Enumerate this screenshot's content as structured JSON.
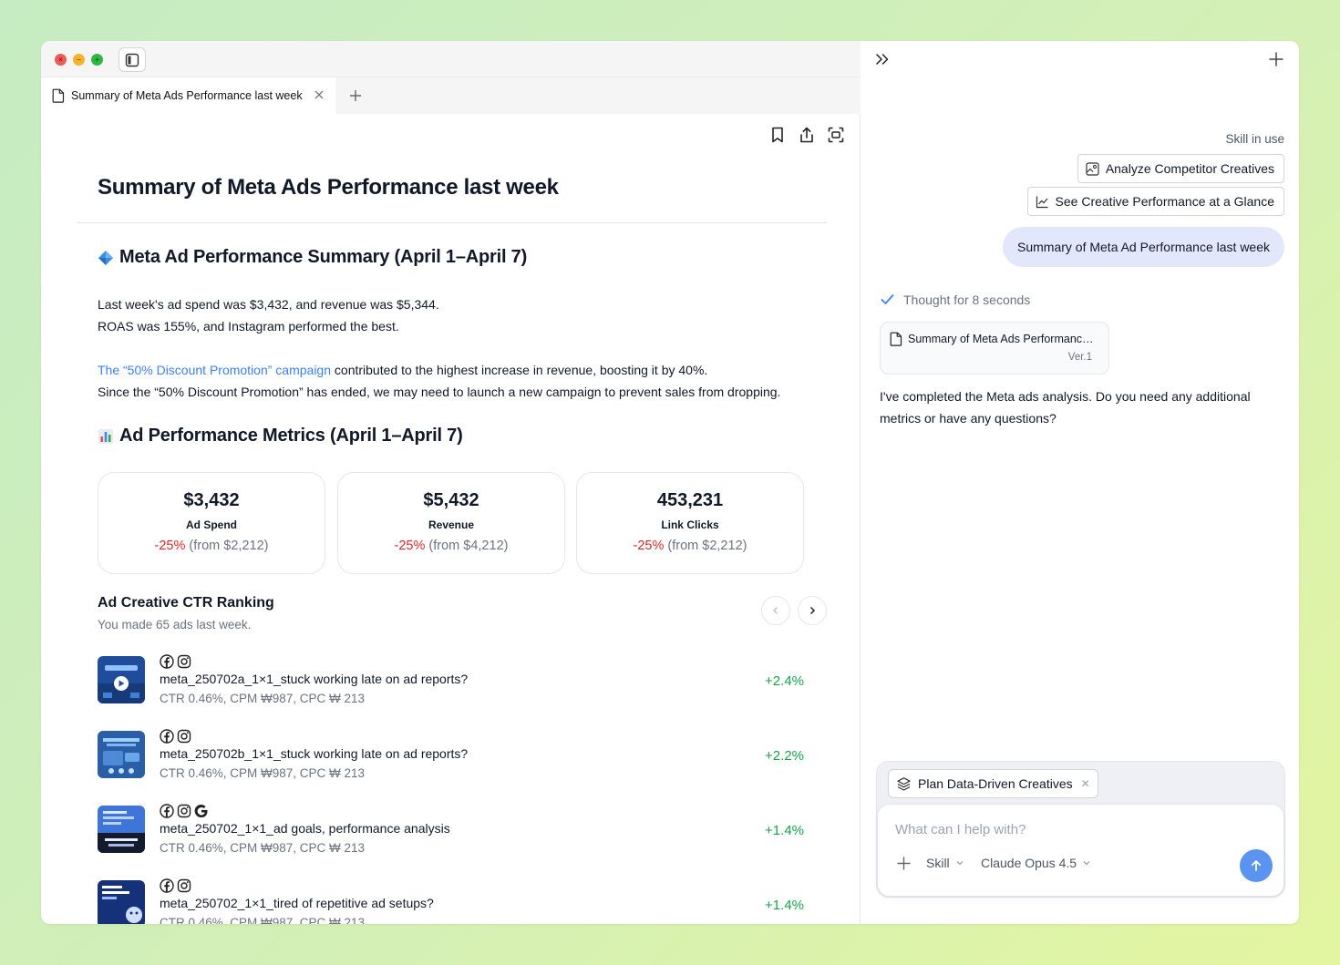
{
  "window": {
    "tab_title": "Summary of Meta Ads Performance last week"
  },
  "doc": {
    "title": "Summary of Meta Ads Performance last week",
    "summary_heading": "Meta Ad Performance Summary (April 1–April 7)",
    "summary_line1": "Last week's ad spend was $3,432, and revenue was $5,344.",
    "summary_line2": "ROAS was 155%, and Instagram performed the best.",
    "campaign_link": "The “50% Discount Promotion” campaign",
    "campaign_rest": " contributed to the highest increase in revenue, boosting it by 40%.",
    "campaign_line2": "Since the “50% Discount Promotion” has ended, we may need to launch a new campaign to prevent sales from dropping.",
    "metrics_heading": "Ad Performance Metrics (April 1–April 7)",
    "metrics": [
      {
        "value": "$3,432",
        "label": "Ad Spend",
        "change": "-25%",
        "from": "(from $2,212)"
      },
      {
        "value": "$5,432",
        "label": "Revenue",
        "change": "-25%",
        "from": "(from $4,212)"
      },
      {
        "value": "453,231",
        "label": "Link Clicks",
        "change": "-25%",
        "from": "(from $2,212)"
      }
    ],
    "ranking": {
      "title": "Ad Creative CTR Ranking",
      "subtitle": "You made 65 ads last week.",
      "ads": [
        {
          "name": "meta_250702a_1×1_stuck working late on ad reports?",
          "stats": "CTR 0.46%, CPM ₩987, CPC ₩ 213",
          "delta": "+2.4%",
          "platforms": [
            "facebook",
            "instagram"
          ]
        },
        {
          "name": "meta_250702b_1×1_stuck working late on ad reports?",
          "stats": "CTR 0.46%, CPM ₩987, CPC ₩ 213",
          "delta": "+2.2%",
          "platforms": [
            "facebook",
            "instagram"
          ]
        },
        {
          "name": "meta_250702_1×1_ad goals, performance analysis",
          "stats": "CTR 0.46%, CPM ₩987, CPC ₩ 213",
          "delta": "+1.4%",
          "platforms": [
            "facebook",
            "instagram",
            "google"
          ]
        },
        {
          "name": "meta_250702_1×1_tired of repetitive ad setups?",
          "stats": "CTR 0.46%, CPM ₩987, CPC ₩ 213",
          "delta": "+1.4%",
          "platforms": [
            "facebook",
            "instagram"
          ]
        }
      ]
    }
  },
  "chat": {
    "skill_label": "Skill in use",
    "skills": [
      "Analyze Competitor Creatives",
      "See Creative Performance at a Glance"
    ],
    "user_message": "Summary of Meta Ad Performance last week",
    "thought": "Thought for 8 seconds",
    "artifact_title": "Summary of Meta Ads Performance last week",
    "artifact_version": "Ver.1",
    "reply": "I've completed the Meta ads analysis. Do you need any additional metrics or have any questions?",
    "composer": {
      "active_skill": "Plan Data-Driven Creatives",
      "placeholder": "What can I help with?",
      "skill_select": "Skill",
      "model_select": "Claude Opus 4.5"
    }
  },
  "colors": {
    "accent_blue": "#3b82f6",
    "negative_red": "#dc2626",
    "positive_green": "#16a34a",
    "user_bubble": "#e3e7fb",
    "send_button": "#5b93f0"
  }
}
